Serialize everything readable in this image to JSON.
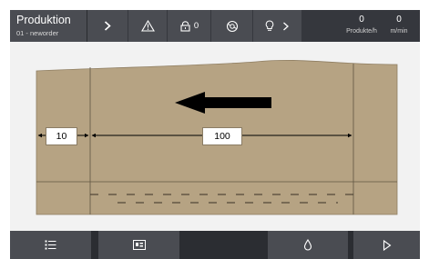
{
  "topbar": {
    "production_title": "Produktion",
    "production_order": "01 - neworder",
    "next_icon": "chevron-right-icon",
    "warning_icon": "warning-triangle-icon",
    "lock_icon": "lock-icon",
    "lock_count": "0",
    "mode_icon": "mode-icon",
    "help_icon": "lightbulb-icon",
    "help_chevron_icon": "chevron-right-icon",
    "rate_value": "0",
    "rate_unit": "Produkte/h",
    "speed_value": "0",
    "speed_unit": "m/min"
  },
  "diagram": {
    "direction_icon": "arrow-left-icon",
    "left_dimension": "10",
    "main_dimension": "100",
    "material_color": "#b6a383"
  },
  "bottombar": {
    "list_icon": "list-icon",
    "layout_icon": "layout-icon",
    "drop_icon": "drop-icon",
    "play_icon": "play-icon"
  }
}
